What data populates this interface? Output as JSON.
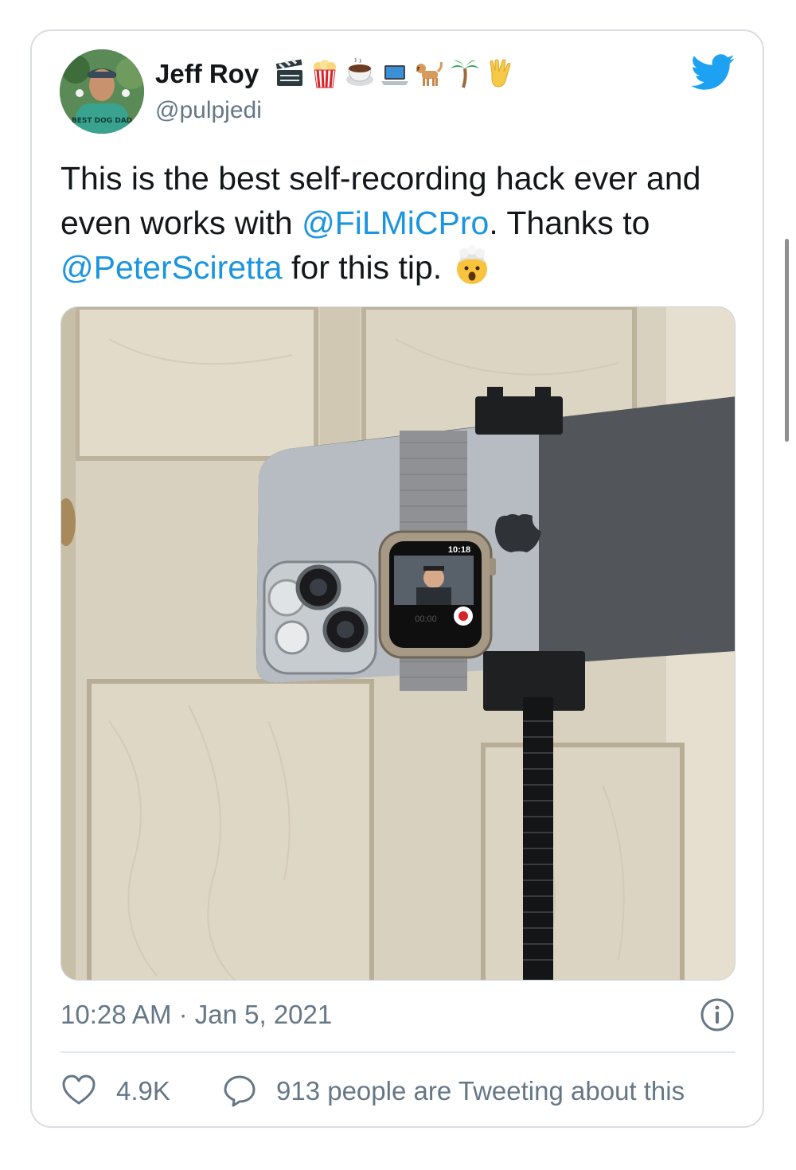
{
  "author": {
    "name": "Jeff Roy",
    "handle": "@pulpjedi",
    "avatar_shirt_text": "BEST DOG DAD",
    "name_emojis": [
      "clapper-board-icon",
      "popcorn-icon",
      "coffee-icon",
      "laptop-icon",
      "dog-icon",
      "palm-tree-icon",
      "vulcan-salute-icon"
    ]
  },
  "tweet": {
    "text_part1": "This is the best self-recording hack ever and even works with ",
    "mention1": "@FiLMiCPro",
    "text_part2": ". Thanks to ",
    "mention2": "@PeterSciretta",
    "text_part3": " for this tip. ",
    "trailing_emoji": "exploding-head-icon"
  },
  "photo": {
    "watch_time": "10:18",
    "watch_timer": "00:00"
  },
  "meta": {
    "timestamp": "10:28 AM · Jan 5, 2021"
  },
  "actions": {
    "likes": "4.9K",
    "tweeting": "913 people are Tweeting about this"
  },
  "colors": {
    "link": "#1b95e0",
    "muted": "#657786",
    "text": "#14171a",
    "twitter_blue": "#1da1f2"
  }
}
